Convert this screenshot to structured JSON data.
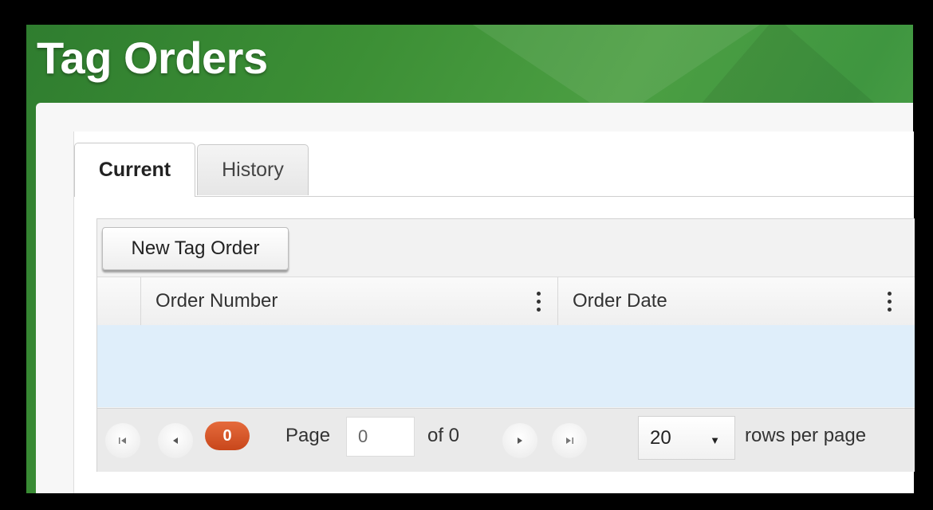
{
  "header": {
    "title": "Tag Orders"
  },
  "tabs": [
    {
      "label": "Current",
      "active": true
    },
    {
      "label": "History",
      "active": false
    }
  ],
  "toolbar": {
    "new_label": "New Tag Order"
  },
  "grid": {
    "columns": [
      "Order Number",
      "Order Date"
    ]
  },
  "pager": {
    "first_icon": "first-page-icon",
    "prev_icon": "prev-page-icon",
    "next_icon": "next-page-icon",
    "last_icon": "last-page-icon",
    "count_badge": "0",
    "page_label": "Page",
    "page_value": "0",
    "of_label": "of 0",
    "rows_value": "20",
    "rows_label": "rows per page"
  },
  "colors": {
    "header_green": "#3c8f35",
    "selected_row": "#dfeefa",
    "badge": "#d9582a"
  }
}
